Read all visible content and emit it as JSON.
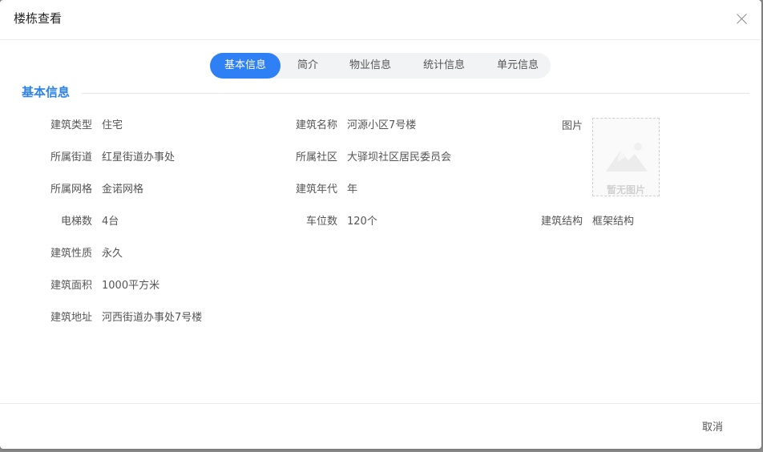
{
  "dialog": {
    "title": "楼栋查看",
    "cancel_label": "取消"
  },
  "tabs": [
    {
      "label": "基本信息",
      "active": true
    },
    {
      "label": "简介",
      "active": false
    },
    {
      "label": "物业信息",
      "active": false
    },
    {
      "label": "统计信息",
      "active": false
    },
    {
      "label": "单元信息",
      "active": false
    }
  ],
  "section": {
    "title": "基本信息"
  },
  "fields": {
    "building_type": {
      "label": "建筑类型",
      "value": "住宅"
    },
    "street": {
      "label": "所属街道",
      "value": "红星街道办事处"
    },
    "grid": {
      "label": "所属网格",
      "value": "金诺网格"
    },
    "elevators": {
      "label": "电梯数",
      "value": "4台"
    },
    "nature": {
      "label": "建筑性质",
      "value": "永久"
    },
    "area": {
      "label": "建筑面积",
      "value": "1000平方米"
    },
    "address": {
      "label": "建筑地址",
      "value": "河西街道办事处7号楼"
    },
    "building_name": {
      "label": "建筑名称",
      "value": "河源小区7号楼"
    },
    "community": {
      "label": "所属社区",
      "value": "大驿坝社区居民委员会"
    },
    "era": {
      "label": "建筑年代",
      "value": "年"
    },
    "parking": {
      "label": "车位数",
      "value": "120个"
    },
    "picture": {
      "label": "图片",
      "placeholder": "暂无图片"
    },
    "structure": {
      "label": "建筑结构",
      "value": "框架结构"
    }
  },
  "colors": {
    "accent": "#2f7ff5",
    "section_title": "#2c82e6"
  }
}
